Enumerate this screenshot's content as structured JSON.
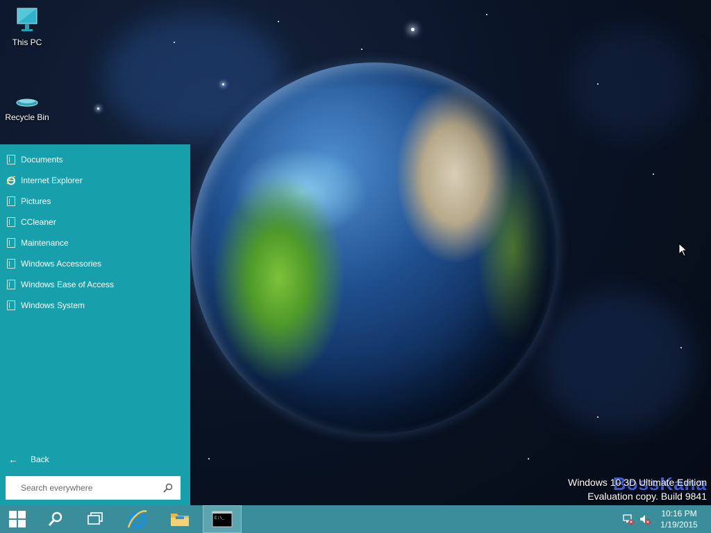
{
  "desktop": {
    "icons": [
      {
        "label": "This PC",
        "icon": "monitor-icon"
      },
      {
        "label": "Recycle Bin",
        "icon": "recycle-bin-icon"
      }
    ],
    "watermark": {
      "line1": "Windows 10 3D Ultimate Edition",
      "line2": "Evaluation copy. Build 9841",
      "brand": "BossKana"
    }
  },
  "start_menu": {
    "items": [
      {
        "label": "Documents",
        "icon": "folder-icon"
      },
      {
        "label": "Internet Explorer",
        "icon": "internet-explorer-icon"
      },
      {
        "label": "Pictures",
        "icon": "folder-icon"
      },
      {
        "label": "CCleaner",
        "icon": "folder-icon"
      },
      {
        "label": "Maintenance",
        "icon": "folder-icon"
      },
      {
        "label": "Windows Accessories",
        "icon": "folder-icon"
      },
      {
        "label": "Windows Ease of Access",
        "icon": "folder-icon"
      },
      {
        "label": "Windows System",
        "icon": "folder-icon"
      }
    ],
    "back_label": "Back",
    "search_placeholder": "Search everywhere"
  },
  "taskbar": {
    "buttons": [
      "start-button",
      "search-button",
      "task-view-button",
      "internet-explorer-button",
      "file-explorer-button",
      "command-prompt-button"
    ],
    "tray": {
      "time": "10:16 PM",
      "date": "1/19/2015",
      "icons": [
        "network-icon",
        "volume-muted-icon"
      ]
    }
  },
  "colors": {
    "start_menu_bg": "#17a0ab",
    "taskbar_bg": "#3a8d9a",
    "accent": "#1e90d8"
  }
}
